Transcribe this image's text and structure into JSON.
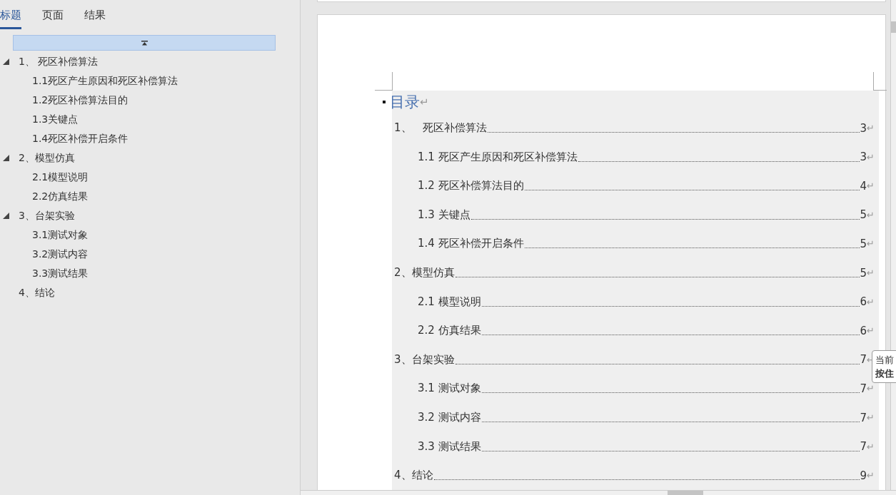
{
  "nav_pane": {
    "tabs": [
      {
        "label": "标题",
        "selected": true
      },
      {
        "label": "页面",
        "selected": false
      },
      {
        "label": "结果",
        "selected": false
      }
    ],
    "headings": [
      {
        "label": "1、 死区补偿算法",
        "expanded": true,
        "children": [
          {
            "label": "1.1死区产生原因和死区补偿算法"
          },
          {
            "label": "1.2死区补偿算法目的"
          },
          {
            "label": "1.3关键点"
          },
          {
            "label": "1.4死区补偿开启条件"
          }
        ]
      },
      {
        "label": "2、模型仿真",
        "expanded": true,
        "children": [
          {
            "label": "2.1模型说明"
          },
          {
            "label": "2.2仿真结果"
          }
        ]
      },
      {
        "label": "3、台架实验",
        "expanded": true,
        "children": [
          {
            "label": "3.1测试对象"
          },
          {
            "label": "3.2测试内容"
          },
          {
            "label": "3.3测试结果"
          }
        ]
      },
      {
        "label": "4、结论"
      }
    ]
  },
  "document": {
    "toc_heading": {
      "text": "目录",
      "mark": "↵"
    },
    "toc_entries": [
      {
        "title": "1、　死区补偿算法",
        "page": "3",
        "mark": "↵",
        "children": [
          {
            "title": "1.1 死区产生原因和死区补偿算法",
            "page": "3",
            "mark": "↵"
          },
          {
            "title": "1.2 死区补偿算法目的",
            "page": "4",
            "mark": "↵"
          },
          {
            "title": "1.3 关键点",
            "page": "5",
            "mark": "↵"
          },
          {
            "title": "1.4 死区补偿开启条件",
            "page": "5",
            "mark": "↵"
          }
        ]
      },
      {
        "title": "2、模型仿真",
        "page": "5",
        "mark": "↵",
        "children": [
          {
            "title": "2.1 模型说明",
            "page": "6",
            "mark": "↵"
          },
          {
            "title": "2.2 仿真结果",
            "page": "6",
            "mark": "↵"
          }
        ]
      },
      {
        "title": "3、台架实验",
        "page": "7",
        "mark": "↵",
        "children": [
          {
            "title": "3.1 测试对象",
            "page": "7",
            "mark": "↵"
          },
          {
            "title": "3.2 测试内容",
            "page": "7",
            "mark": "↵"
          },
          {
            "title": "3.3 测试结果",
            "page": "7",
            "mark": "↵"
          }
        ]
      },
      {
        "title": "4、结论",
        "page": "9",
        "mark": "↵"
      }
    ],
    "tooltip": {
      "lines": [
        "当前",
        "按住"
      ]
    }
  }
}
